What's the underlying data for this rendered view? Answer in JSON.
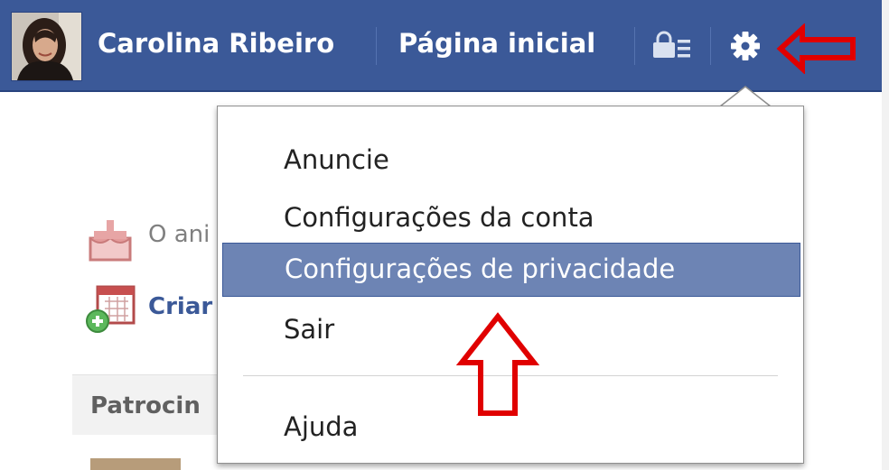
{
  "header": {
    "user_name": "Carolina Ribeiro",
    "home_label": "Página inicial"
  },
  "account_menu": {
    "items": [
      {
        "label": "Anuncie",
        "selected": false
      },
      {
        "label": "Configurações da conta",
        "selected": false
      },
      {
        "label": "Configurações de privacidade",
        "selected": true
      },
      {
        "label": "Sair",
        "selected": false
      },
      {
        "label": "Ajuda",
        "selected": false
      }
    ]
  },
  "left_column": {
    "birthday_text": "O ani",
    "create_text": "Criar",
    "sponsored_heading": "Patrocin"
  },
  "icons": {
    "privacy": "privacy-shortcut-icon",
    "gear": "gear-icon",
    "birthday": "birthday-cake-icon",
    "create_event": "calendar-add-icon"
  },
  "colors": {
    "topbar": "#3b5998",
    "menu_highlight": "#6d84b4",
    "annotation_arrow": "#e00000"
  }
}
